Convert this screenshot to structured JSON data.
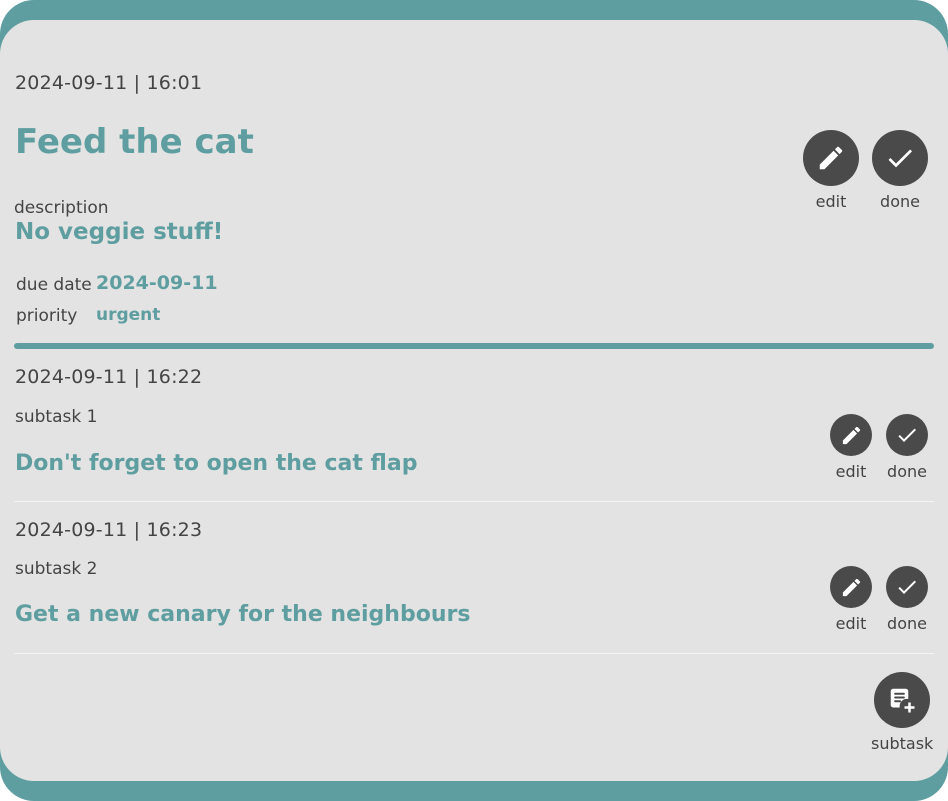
{
  "task": {
    "created": "2024-09-11 | 16:01",
    "title": "Feed the cat",
    "description_label": "description",
    "description": "No veggie stuff!",
    "due_label": "due date",
    "due_date": "2024-09-11",
    "priority_label": "priority",
    "priority": "urgent",
    "edit_label": "edit",
    "done_label": "done"
  },
  "subtasks": [
    {
      "created": "2024-09-11 | 16:22",
      "name": "subtask 1",
      "text": "Don't forget to open the cat flap",
      "edit_label": "edit",
      "done_label": "done"
    },
    {
      "created": "2024-09-11 | 16:23",
      "name": "subtask 2",
      "text": "Get a new canary for the neighbours",
      "edit_label": "edit",
      "done_label": "done"
    }
  ],
  "add_subtask_label": "subtask",
  "colors": {
    "accent": "#5f9ea0",
    "card_bg": "#e3e3e3",
    "button_bg": "#4a4a4a",
    "text": "#444444"
  },
  "icons": {
    "edit": "pencil-icon",
    "done": "check-icon",
    "subtask": "note-add-icon"
  }
}
